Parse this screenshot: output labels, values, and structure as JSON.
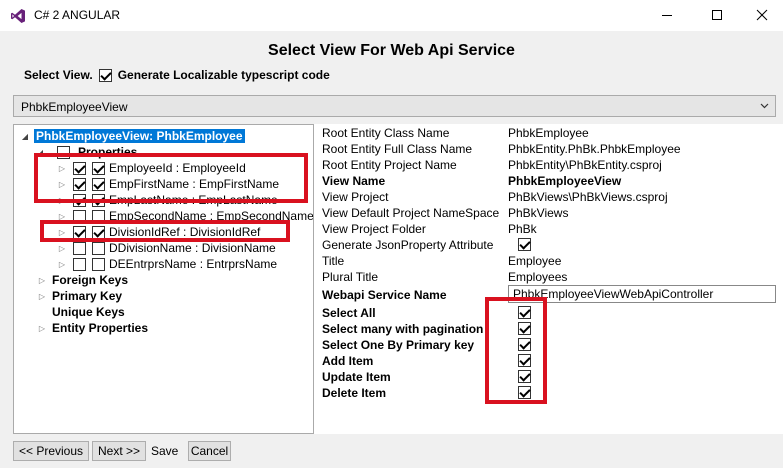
{
  "window": {
    "title": "C# 2 ANGULAR",
    "icons": {
      "logo": "visual-studio-logo-icon",
      "minimize": "minimize-icon",
      "maximize": "maximize-icon",
      "close": "close-icon"
    }
  },
  "heading": "Select View For Web Api Service",
  "select_view": {
    "label": "Select View.",
    "generate_localizable": {
      "label": "Generate Localizable typescript code",
      "checked": true
    }
  },
  "view_dropdown": {
    "selected": "PhbkEmployeeView"
  },
  "tree": {
    "root": "PhbkEmployeeView: PhbkEmployee",
    "properties_label": "Properties",
    "properties": [
      {
        "label": "EmployeeId : EmployeeId",
        "checked": true
      },
      {
        "label": "EmpFirstName : EmpFirstName",
        "checked": true
      },
      {
        "label": "EmpLastName : EmpLastName",
        "checked": true
      },
      {
        "label": "EmpSecondName : EmpSecondName",
        "checked": false
      },
      {
        "label": "DivisionIdRef : DivisionIdRef",
        "checked": true
      },
      {
        "label": "DDivisionName : DivisionName",
        "checked": false
      },
      {
        "label": "DEEntrprsName : EntrprsName",
        "checked": false
      }
    ],
    "groups": [
      "Foreign Keys",
      "Primary Key",
      "Unique Keys",
      "Entity Properties"
    ]
  },
  "properties_panel": {
    "root_entity_class_name": {
      "label": "Root Entity Class Name",
      "value": "PhbkEmployee"
    },
    "root_entity_full_class_name": {
      "label": "Root Entity Full Class Name",
      "value": "PhbkEntity.PhBk.PhbkEmployee"
    },
    "root_entity_project_name": {
      "label": "Root Entity Project Name",
      "value": "PhbkEntity\\PhBkEntity.csproj"
    },
    "view_name": {
      "label": "View Name",
      "value": "PhbkEmployeeView"
    },
    "view_project": {
      "label": "View Project",
      "value": "PhBkViews\\PhBkViews.csproj"
    },
    "view_default_project_namespace": {
      "label": "View Default Project NameSpace",
      "value": "PhBkViews"
    },
    "view_project_folder": {
      "label": "View Project Folder",
      "value": "PhBk"
    },
    "generate_json_property_attribute": {
      "label": "Generate JsonProperty Attribute",
      "checked": true
    },
    "title": {
      "label": "Title",
      "value": "Employee"
    },
    "plural_title": {
      "label": "Plural Title",
      "value": "Employees"
    },
    "webapi_service_name": {
      "label": "Webapi Service Name",
      "value": "PhbkEmployeeViewWebApiController"
    },
    "select_all": {
      "label": "Select All",
      "checked": true
    },
    "select_many_with_pagination": {
      "label": "Select many with pagination",
      "checked": true
    },
    "select_one_by_primary_key": {
      "label": "Select One By Primary key",
      "checked": true
    },
    "add_item": {
      "label": "Add Item",
      "checked": true
    },
    "update_item": {
      "label": "Update Item",
      "checked": true
    },
    "delete_item": {
      "label": "Delete Item",
      "checked": true
    }
  },
  "footer": {
    "previous": "<< Previous",
    "next": "Next >>",
    "save": "Save",
    "cancel": "Cancel"
  },
  "colors": {
    "highlight": "#d9111f",
    "selection": "#0078d7",
    "vs_purple": "#68217a"
  }
}
